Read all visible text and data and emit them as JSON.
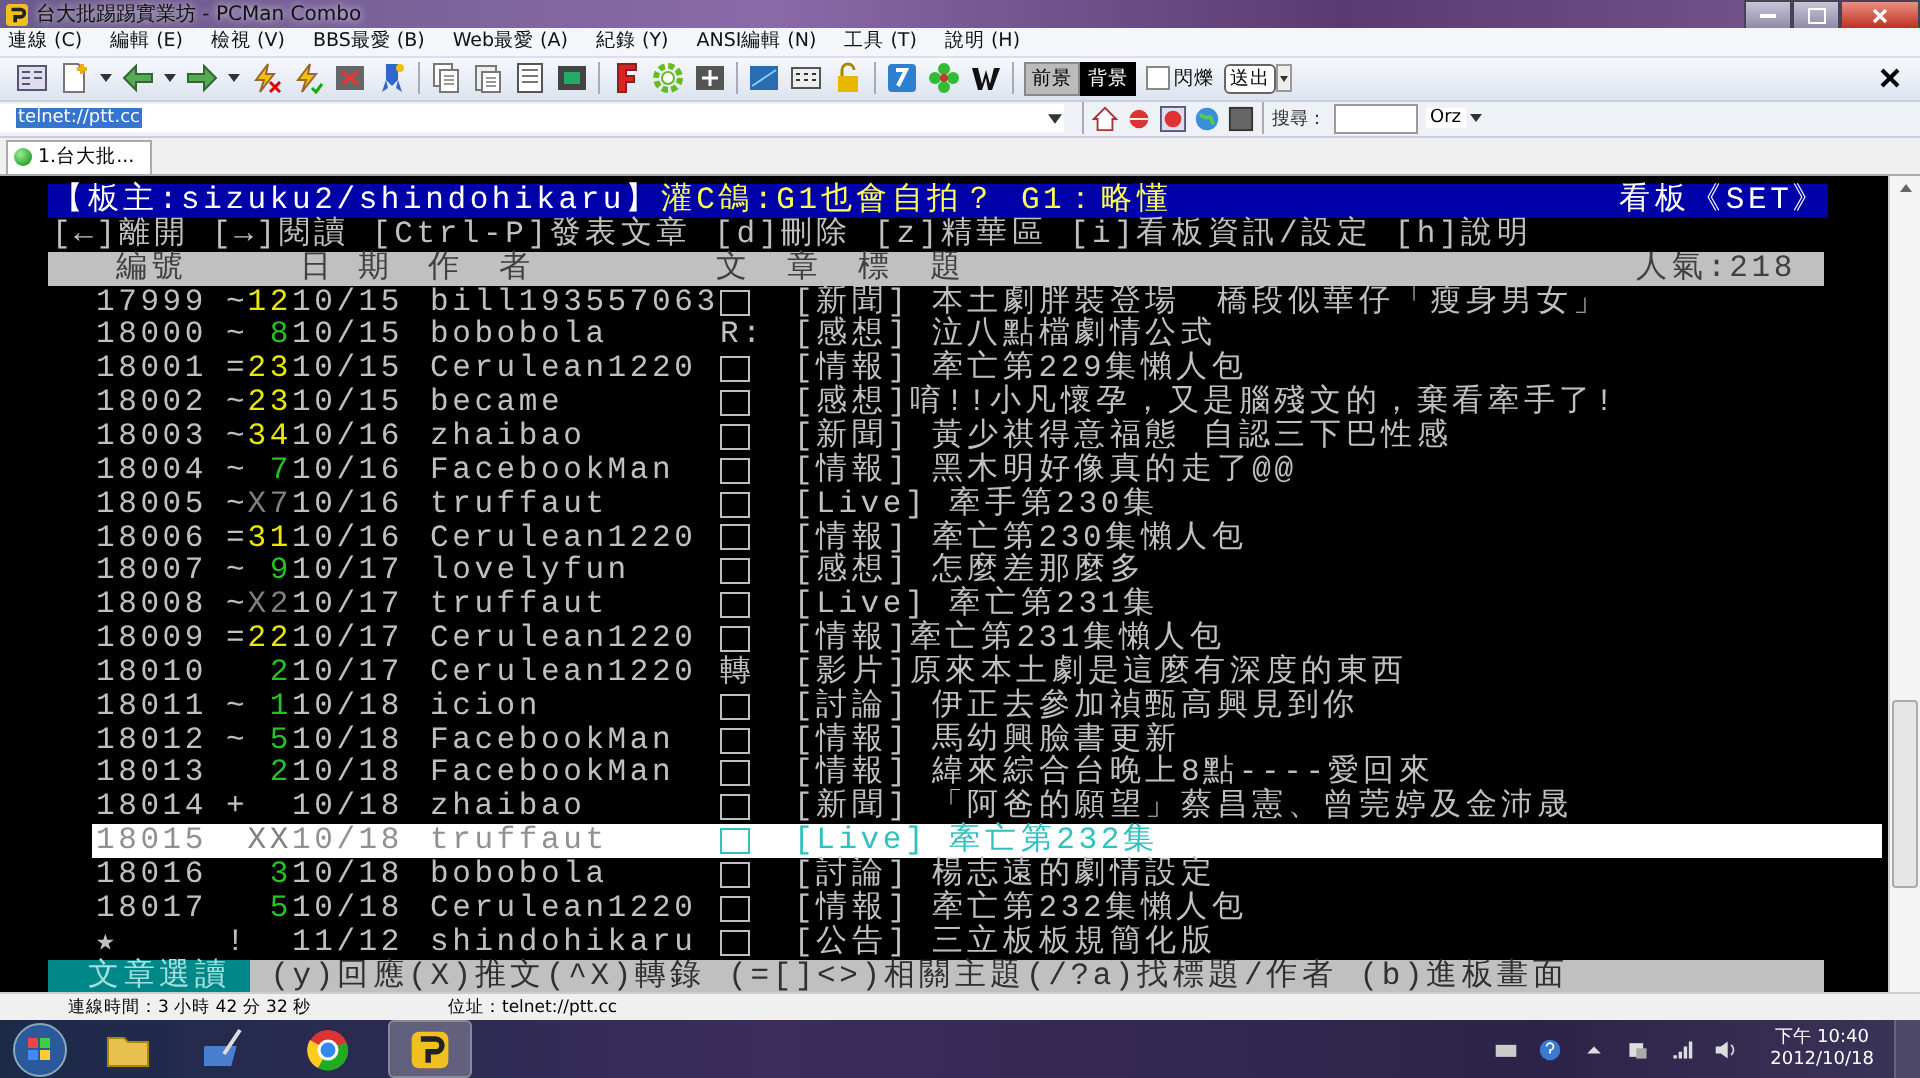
{
  "window": {
    "title": "台大批踢踢實業坊 - PCMan Combo"
  },
  "menu": [
    "連線 (C)",
    "編輯 (E)",
    "檢視 (V)",
    "BBS最愛 (B)",
    "Web最愛 (A)",
    "紀錄 (Y)",
    "ANSI編輯 (N)",
    "工具 (T)",
    "說明 (H)"
  ],
  "toolbar": {
    "fg_button": "前景",
    "bg_button": "背景",
    "blink": {
      "label": "閃爍",
      "checked": false
    },
    "send_button": "送出"
  },
  "address": {
    "value": "telnet://ptt.cc",
    "search_label": "搜尋：",
    "search_engine": "Orz"
  },
  "tabs": [
    {
      "label": "1.台大批...",
      "selected": true
    }
  ],
  "terminal": {
    "header": {
      "board_master": "【板主:sizuku2/shindohikaru】",
      "slogan": "灌C鴿:G1也會自拍？ G1：略懂",
      "board": "看板《SET》"
    },
    "help_line": "[←]離開 [→]閱讀 [Ctrl-P]發表文章 [d]刪除 [z]精華區 [i]看板資訊/設定 [h]說明",
    "columns": {
      "number": "編號",
      "date": "日 期",
      "author": "作　者",
      "title": "文　章　標　題",
      "popularity": "人氣:218"
    },
    "rows": [
      {
        "number": "17999",
        "mark": "~",
        "count": {
          "text": "12",
          "color": "#e8e800"
        },
        "date": "10/15",
        "author": "bill193557063",
        "flag": {
          "kind": "box"
        },
        "subject": "[新聞] 本土劇胖裝登場　橋段似華仔「瘦身男女」",
        "selected": false
      },
      {
        "number": "18000",
        "mark": "~",
        "count": {
          "text": "8",
          "color": "#22c322"
        },
        "date": "10/15",
        "author": "bobobola",
        "flag": {
          "kind": "text",
          "text": "R:"
        },
        "subject": "[感想] 泣八點檔劇情公式",
        "selected": false
      },
      {
        "number": "18001",
        "mark": "=",
        "count": {
          "text": "23",
          "color": "#e8e800"
        },
        "date": "10/15",
        "author": "Cerulean1220",
        "flag": {
          "kind": "box"
        },
        "subject": "[情報] 牽亡第229集懶人包",
        "selected": false
      },
      {
        "number": "18002",
        "mark": "~",
        "count": {
          "text": "23",
          "color": "#e8e800"
        },
        "date": "10/15",
        "author": "became",
        "flag": {
          "kind": "box"
        },
        "subject": "[感想]唷!!小凡懷孕，又是腦殘文的，棄看牽手了!",
        "selected": false
      },
      {
        "number": "18003",
        "mark": "~",
        "count": {
          "text": "34",
          "color": "#e8e800"
        },
        "date": "10/16",
        "author": "zhaibao",
        "flag": {
          "kind": "box"
        },
        "subject": "[新聞] 黃少祺得意福態 自認三下巴性感",
        "selected": false
      },
      {
        "number": "18004",
        "mark": "~",
        "count": {
          "text": "7",
          "color": "#22c322"
        },
        "date": "10/16",
        "author": "FacebookMan",
        "flag": {
          "kind": "box"
        },
        "subject": "[情報] 黑木明好像真的走了@@",
        "selected": false
      },
      {
        "number": "18005",
        "mark": "~",
        "count": {
          "text": "X7",
          "color": "#808080"
        },
        "date": "10/16",
        "author": "truffaut",
        "flag": {
          "kind": "box"
        },
        "subject": "[Live] 牽手第230集",
        "selected": false
      },
      {
        "number": "18006",
        "mark": "=",
        "count": {
          "text": "31",
          "color": "#e8e800"
        },
        "date": "10/16",
        "author": "Cerulean1220",
        "flag": {
          "kind": "box"
        },
        "subject": "[情報] 牽亡第230集懶人包",
        "selected": false
      },
      {
        "number": "18007",
        "mark": "~",
        "count": {
          "text": "9",
          "color": "#22c322"
        },
        "date": "10/17",
        "author": "lovelyfun",
        "flag": {
          "kind": "box"
        },
        "subject": "[感想] 怎麼差那麼多",
        "selected": false
      },
      {
        "number": "18008",
        "mark": "~",
        "count": {
          "text": "X2",
          "color": "#808080"
        },
        "date": "10/17",
        "author": "truffaut",
        "flag": {
          "kind": "box"
        },
        "subject": "[Live] 牽亡第231集",
        "selected": false
      },
      {
        "number": "18009",
        "mark": "=",
        "count": {
          "text": "22",
          "color": "#e8e800"
        },
        "date": "10/17",
        "author": "Cerulean1220",
        "flag": {
          "kind": "box"
        },
        "subject": "[情報]牽亡第231集懶人包",
        "selected": false
      },
      {
        "number": "18010",
        "count": {
          "text": "2",
          "color": "#22c322"
        },
        "date": "10/17",
        "author": "Cerulean1220",
        "flag": {
          "kind": "text",
          "text": "轉"
        },
        "subject": "[影片]原來本土劇是這麼有深度的東西",
        "selected": false
      },
      {
        "number": "18011",
        "mark": "~",
        "count": {
          "text": "1",
          "color": "#22c322"
        },
        "date": "10/18",
        "author": "icion",
        "flag": {
          "kind": "box"
        },
        "subject": "[討論] 伊正去參加禎甄高興見到你",
        "selected": false
      },
      {
        "number": "18012",
        "mark": "~",
        "count": {
          "text": "5",
          "color": "#22c322"
        },
        "date": "10/18",
        "author": "FacebookMan",
        "flag": {
          "kind": "box"
        },
        "subject": "[情報] 馬幼興臉書更新",
        "selected": false
      },
      {
        "number": "18013",
        "count": {
          "text": "2",
          "color": "#22c322"
        },
        "date": "10/18",
        "author": "FacebookMan",
        "flag": {
          "kind": "box"
        },
        "subject": "[情報] 緯來綜合台晚上8點----愛回來",
        "selected": false
      },
      {
        "number": "18014",
        "mark": "+",
        "date": "10/18",
        "author": "zhaibao",
        "flag": {
          "kind": "box"
        },
        "subject": "[新聞] 「阿爸的願望」蔡昌憲、曾莞婷及金沛晟",
        "selected": false
      },
      {
        "number": "18015",
        "count": {
          "text": "XX",
          "color": "#808080"
        },
        "date": "10/18",
        "author": "truffaut",
        "flag": {
          "kind": "box"
        },
        "subject": "[Live] 牽亡第232集",
        "selected": true
      },
      {
        "number": "18016",
        "count": {
          "text": "3",
          "color": "#22c322"
        },
        "date": "10/18",
        "author": "bobobola",
        "flag": {
          "kind": "box"
        },
        "subject": "[討論] 楊志遠的劇情設定",
        "selected": false
      },
      {
        "number": "18017",
        "count": {
          "text": "5",
          "color": "#22c322"
        },
        "date": "10/18",
        "author": "Cerulean1220",
        "flag": {
          "kind": "box"
        },
        "subject": "[情報] 牽亡第232集懶人包",
        "selected": false
      },
      {
        "number": "★",
        "mark": "!",
        "date": "11/12",
        "author": "shindohikaru",
        "flag": {
          "kind": "box"
        },
        "subject": "[公告] 三立板板規簡化版",
        "selected": false
      }
    ],
    "footer": {
      "mode": "文章選讀",
      "help": "(y)回應(X)推文(^X)轉錄 (=[]<>)相關主題(/?a)找標題/作者 (b)進板畫面"
    }
  },
  "status_bar": {
    "connection_time": "連線時間：3 小時 42 分 32 秒",
    "address": "位址：telnet://ptt.cc"
  },
  "taskbar": {
    "time": "下午 10:40",
    "date": "2012/10/18"
  }
}
